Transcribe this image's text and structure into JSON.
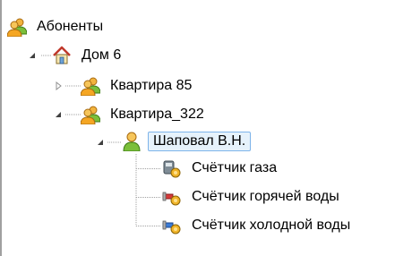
{
  "tree": {
    "root": {
      "label": "Абоненты",
      "icon": "people-group-icon"
    },
    "house": {
      "label": "Дом 6",
      "icon": "house-icon",
      "expanded": true
    },
    "apartments": [
      {
        "label": "Квартира 85",
        "icon": "people-group-icon",
        "expanded": false
      },
      {
        "label": "Квартира_322",
        "icon": "people-group-icon",
        "expanded": true
      }
    ],
    "person": {
      "label": "Шаповал В.Н.",
      "icon": "person-icon",
      "selected": true
    },
    "meters": [
      {
        "label": "Счётчик газа",
        "icon": "gas-meter-icon"
      },
      {
        "label": "Счётчик горячей воды",
        "icon": "hot-water-meter-icon"
      },
      {
        "label": "Счётчик холодной воды",
        "icon": "cold-water-meter-icon"
      }
    ]
  },
  "colors": {
    "selection_background": "#e6f2fb",
    "selection_border": "#7eb4ea",
    "connector_dots": "#a0a0a0"
  }
}
